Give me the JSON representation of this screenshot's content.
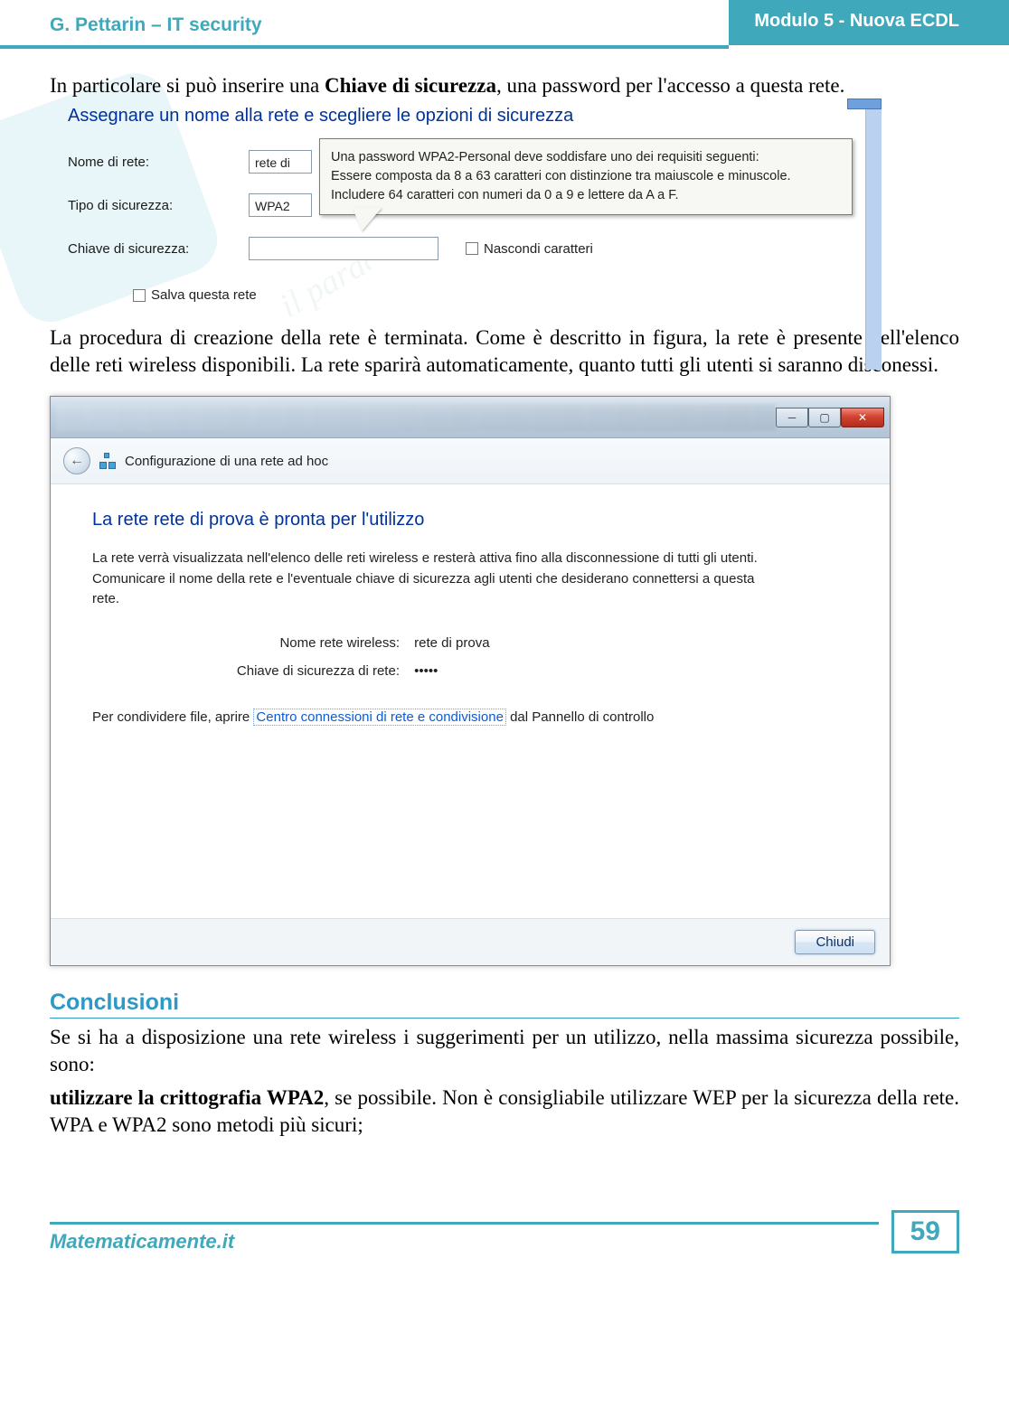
{
  "header": {
    "left": "G. Pettarin – IT security",
    "right": "Modulo 5 - Nuova ECDL"
  },
  "para1_pre": "In particolare si può inserire una ",
  "para1_bold": "Chiave di sicurezza",
  "para1_post": ", una password per l'accesso a questa rete.",
  "fig1": {
    "title": "Assegnare un nome alla rete e scegliere le opzioni di sicurezza",
    "label_name": "Nome di rete:",
    "value_name": "rete di",
    "label_type": "Tipo di sicurezza:",
    "value_type": "WPA2",
    "label_key": "Chiave di sicurezza:",
    "value_key": "",
    "hide_chars": "Nascondi caratteri",
    "save_net": "Salva questa rete",
    "tooltip_l1": "Una password WPA2-Personal deve soddisfare uno dei requisiti seguenti:",
    "tooltip_l2": "Essere composta da 8 a 63 caratteri con distinzione tra maiuscole e minuscole.",
    "tooltip_l3": "Includere 64 caratteri con numeri da 0 a 9 e lettere da A a F."
  },
  "para2": "La procedura di creazione della rete è terminata. Come è descritto in figura, la rete è presente nell'elenco delle reti wireless disponibili. La rete sparirà automaticamente, quanto tutti gli utenti si saranno disconessi.",
  "fig2": {
    "breadcrumb": "Configurazione di una rete ad hoc",
    "heading": "La rete rete di prova è pronta per l'utilizzo",
    "desc": "La rete verrà visualizzata nell'elenco delle reti wireless e resterà attiva fino alla disconnessione di tutti gli utenti. Comunicare il nome della rete e l'eventuale chiave di sicurezza agli utenti che desiderano connettersi a questa rete.",
    "kv_name_label": "Nome rete wireless:",
    "kv_name_value": "rete di prova",
    "kv_key_label": "Chiave di sicurezza di rete:",
    "kv_key_value": "•••••",
    "share_pre": "Per condividere file, aprire ",
    "share_link": "Centro connessioni di rete e condivisione",
    "share_post": " dal Pannello di controllo",
    "close_btn": "Chiudi"
  },
  "section_title": "Conclusioni",
  "para3": "Se si ha a disposizione una rete wireless i suggerimenti per un utilizzo, nella massima sicurezza possibile, sono:",
  "para4_bold": "utilizzare la crittografia WPA2",
  "para4_post": ", se possibile. Non è consigliabile utilizzare WEP per la sicurezza della rete. WPA e WPA2 sono metodi più sicuri;",
  "footer": {
    "site": "Matematicamente.it",
    "page": "59"
  }
}
